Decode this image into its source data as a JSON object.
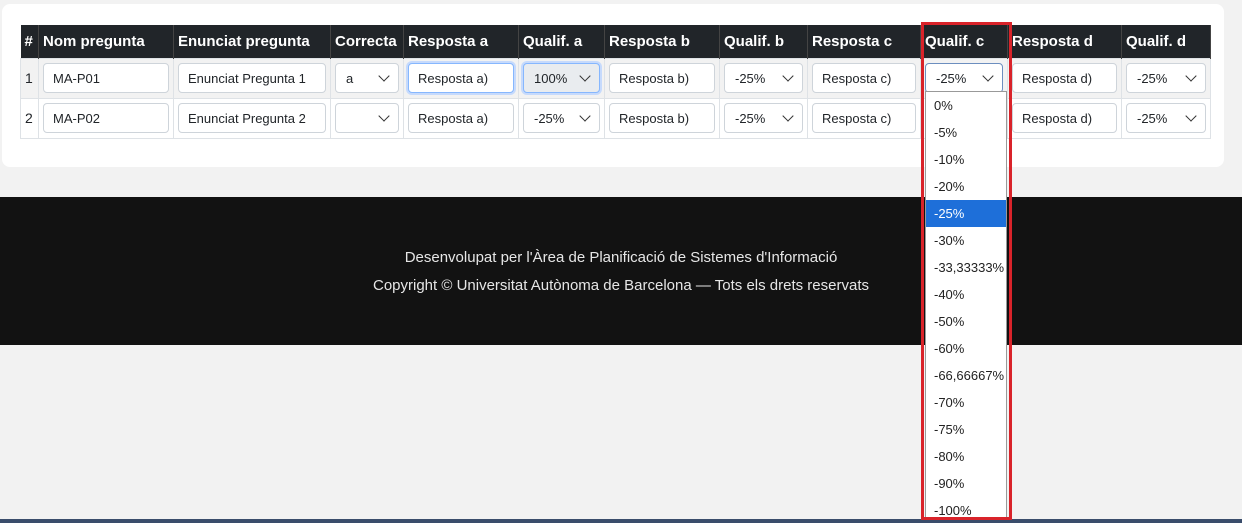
{
  "table": {
    "headers": [
      "#",
      "Nom pregunta",
      "Enunciat pregunta",
      "Correcta",
      "Resposta a",
      "Qualif. a",
      "Resposta b",
      "Qualif. b",
      "Resposta c",
      "Qualif. c",
      "Resposta d",
      "Qualif. d"
    ],
    "rows": [
      {
        "num": "1",
        "nom": "MA-P01",
        "enunciat": "Enunciat Pregunta 1",
        "correcta": "a",
        "resp_a": "Resposta a)",
        "qual_a": "100%",
        "resp_b": "Resposta b)",
        "qual_b": "-25%",
        "resp_c": "Resposta c)",
        "qual_c": "-25%",
        "resp_d": "Resposta d)",
        "qual_d": "-25%"
      },
      {
        "num": "2",
        "nom": "MA-P02",
        "enunciat": "Enunciat Pregunta 2",
        "correcta": "",
        "resp_a": "Resposta a)",
        "qual_a": "-25%",
        "resp_b": "Resposta b)",
        "qual_b": "-25%",
        "resp_c": "Resposta c)",
        "qual_c": "",
        "resp_d": "Resposta d)",
        "qual_d": "-25%"
      }
    ]
  },
  "dropdown": {
    "options": [
      "0%",
      "-5%",
      "-10%",
      "-20%",
      "-25%",
      "-30%",
      "-33,33333%",
      "-40%",
      "-50%",
      "-60%",
      "-66,66667%",
      "-70%",
      "-75%",
      "-80%",
      "-90%",
      "-100%"
    ],
    "selected": "-25%"
  },
  "footer": {
    "line1": "Desenvolupat per l'Àrea de Planificació de Sistemes d'Informació",
    "line2": "Copyright © Universitat Autònoma de Barcelona — Tots els drets reservats"
  },
  "colors": {
    "header_bg": "#212529",
    "footer_bg": "#121212",
    "highlight": "#d9232a",
    "option_selected": "#1e6fd9"
  }
}
